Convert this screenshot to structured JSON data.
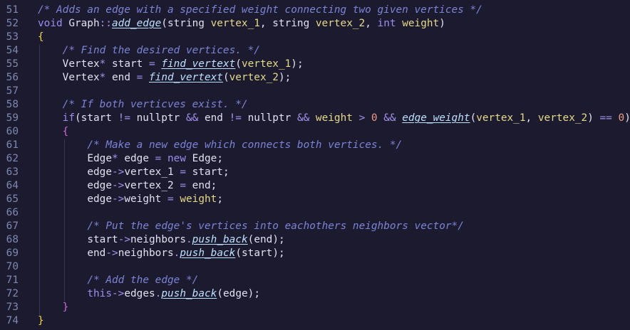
{
  "editor": {
    "lines": [
      {
        "n": "51",
        "indent": 0,
        "tokens": [
          {
            "t": "/* Adds an edge with a specified weight connecting two given vertices */",
            "c": "comment"
          }
        ]
      },
      {
        "n": "52",
        "indent": 0,
        "tokens": [
          {
            "t": "void",
            "c": "kw"
          },
          {
            "t": " Graph",
            "c": "plain"
          },
          {
            "t": "::",
            "c": "scope"
          },
          {
            "t": "add_edge",
            "c": "fn"
          },
          {
            "t": "(",
            "c": "paren"
          },
          {
            "t": "string",
            "c": "plain"
          },
          {
            "t": " vertex_1",
            "c": "param"
          },
          {
            "t": ", ",
            "c": "plain"
          },
          {
            "t": "string",
            "c": "plain"
          },
          {
            "t": " vertex_2",
            "c": "param"
          },
          {
            "t": ", ",
            "c": "plain"
          },
          {
            "t": "int",
            "c": "kw"
          },
          {
            "t": " weight",
            "c": "param"
          },
          {
            "t": ")",
            "c": "paren"
          }
        ]
      },
      {
        "n": "53",
        "indent": 0,
        "tokens": [
          {
            "t": "{",
            "c": "brace1"
          }
        ]
      },
      {
        "n": "54",
        "indent": 1,
        "tokens": [
          {
            "t": "/* Find the desired vertices. */",
            "c": "comment"
          }
        ]
      },
      {
        "n": "55",
        "indent": 1,
        "tokens": [
          {
            "t": "Vertex",
            "c": "plain"
          },
          {
            "t": "*",
            "c": "op"
          },
          {
            "t": " start ",
            "c": "plain"
          },
          {
            "t": "=",
            "c": "op"
          },
          {
            "t": " ",
            "c": "plain"
          },
          {
            "t": "find_vertext",
            "c": "fn"
          },
          {
            "t": "(",
            "c": "paren"
          },
          {
            "t": "vertex_1",
            "c": "param"
          },
          {
            "t": ");",
            "c": "paren"
          }
        ]
      },
      {
        "n": "56",
        "indent": 1,
        "tokens": [
          {
            "t": "Vertex",
            "c": "plain"
          },
          {
            "t": "*",
            "c": "op"
          },
          {
            "t": " end ",
            "c": "plain"
          },
          {
            "t": "=",
            "c": "op"
          },
          {
            "t": " ",
            "c": "plain"
          },
          {
            "t": "find_vertext",
            "c": "fn"
          },
          {
            "t": "(",
            "c": "paren"
          },
          {
            "t": "vertex_2",
            "c": "param"
          },
          {
            "t": ");",
            "c": "paren"
          }
        ]
      },
      {
        "n": "57",
        "indent": 1,
        "tokens": []
      },
      {
        "n": "58",
        "indent": 1,
        "tokens": [
          {
            "t": "/* If both verticves exist. */",
            "c": "comment"
          }
        ]
      },
      {
        "n": "59",
        "indent": 1,
        "tokens": [
          {
            "t": "if",
            "c": "kw"
          },
          {
            "t": "(",
            "c": "paren"
          },
          {
            "t": "start ",
            "c": "plain"
          },
          {
            "t": "!=",
            "c": "op"
          },
          {
            "t": " nullptr ",
            "c": "plain"
          },
          {
            "t": "&&",
            "c": "op"
          },
          {
            "t": " end ",
            "c": "plain"
          },
          {
            "t": "!=",
            "c": "op"
          },
          {
            "t": " nullptr ",
            "c": "plain"
          },
          {
            "t": "&&",
            "c": "op"
          },
          {
            "t": " weight",
            "c": "param"
          },
          {
            "t": " > ",
            "c": "op"
          },
          {
            "t": "0",
            "c": "num"
          },
          {
            "t": " && ",
            "c": "op"
          },
          {
            "t": "edge_weight",
            "c": "fn"
          },
          {
            "t": "(",
            "c": "paren"
          },
          {
            "t": "vertex_1",
            "c": "param"
          },
          {
            "t": ", ",
            "c": "plain"
          },
          {
            "t": "vertex_2",
            "c": "param"
          },
          {
            "t": ")",
            "c": "paren"
          },
          {
            "t": " == ",
            "c": "op"
          },
          {
            "t": "0",
            "c": "num"
          },
          {
            "t": ")",
            "c": "paren"
          }
        ]
      },
      {
        "n": "60",
        "indent": 1,
        "tokens": [
          {
            "t": "{",
            "c": "brace2"
          }
        ]
      },
      {
        "n": "61",
        "indent": 2,
        "tokens": [
          {
            "t": "/* Make a new edge which connects both vertices. */",
            "c": "comment"
          }
        ]
      },
      {
        "n": "62",
        "indent": 2,
        "tokens": [
          {
            "t": "Edge",
            "c": "plain"
          },
          {
            "t": "*",
            "c": "op"
          },
          {
            "t": " edge ",
            "c": "plain"
          },
          {
            "t": "=",
            "c": "op"
          },
          {
            "t": " new",
            "c": "kw"
          },
          {
            "t": " Edge;",
            "c": "plain"
          }
        ]
      },
      {
        "n": "63",
        "indent": 2,
        "tokens": [
          {
            "t": "edge",
            "c": "plain"
          },
          {
            "t": "->",
            "c": "op"
          },
          {
            "t": "vertex_1",
            "c": "plain"
          },
          {
            "t": " = ",
            "c": "op"
          },
          {
            "t": "start;",
            "c": "plain"
          }
        ]
      },
      {
        "n": "64",
        "indent": 2,
        "tokens": [
          {
            "t": "edge",
            "c": "plain"
          },
          {
            "t": "->",
            "c": "op"
          },
          {
            "t": "vertex_2",
            "c": "plain"
          },
          {
            "t": " = ",
            "c": "op"
          },
          {
            "t": "end;",
            "c": "plain"
          }
        ]
      },
      {
        "n": "65",
        "indent": 2,
        "tokens": [
          {
            "t": "edge",
            "c": "plain"
          },
          {
            "t": "->",
            "c": "op"
          },
          {
            "t": "weight",
            "c": "plain"
          },
          {
            "t": " = ",
            "c": "op"
          },
          {
            "t": "weight",
            "c": "param"
          },
          {
            "t": ";",
            "c": "plain"
          }
        ]
      },
      {
        "n": "66",
        "indent": 2,
        "tokens": []
      },
      {
        "n": "67",
        "indent": 2,
        "tokens": [
          {
            "t": "/* Put the edge's vertices into eachothers neighbors vector*/",
            "c": "comment"
          }
        ]
      },
      {
        "n": "68",
        "indent": 2,
        "tokens": [
          {
            "t": "start",
            "c": "plain"
          },
          {
            "t": "->",
            "c": "op"
          },
          {
            "t": "neighbors",
            "c": "plain"
          },
          {
            "t": ".",
            "c": "op"
          },
          {
            "t": "push_back",
            "c": "fn"
          },
          {
            "t": "(",
            "c": "paren"
          },
          {
            "t": "end",
            "c": "plain"
          },
          {
            "t": ");",
            "c": "paren"
          }
        ]
      },
      {
        "n": "69",
        "indent": 2,
        "tokens": [
          {
            "t": "end",
            "c": "plain"
          },
          {
            "t": "->",
            "c": "op"
          },
          {
            "t": "neighbors",
            "c": "plain"
          },
          {
            "t": ".",
            "c": "op"
          },
          {
            "t": "push_back",
            "c": "fn"
          },
          {
            "t": "(",
            "c": "paren"
          },
          {
            "t": "start",
            "c": "plain"
          },
          {
            "t": ");",
            "c": "paren"
          }
        ]
      },
      {
        "n": "70",
        "indent": 2,
        "tokens": []
      },
      {
        "n": "71",
        "indent": 2,
        "tokens": [
          {
            "t": "/* Add the edge */",
            "c": "comment"
          }
        ]
      },
      {
        "n": "72",
        "indent": 2,
        "tokens": [
          {
            "t": "this",
            "c": "kw"
          },
          {
            "t": "->",
            "c": "op"
          },
          {
            "t": "edges",
            "c": "plain"
          },
          {
            "t": ".",
            "c": "op"
          },
          {
            "t": "push_back",
            "c": "fn"
          },
          {
            "t": "(",
            "c": "paren"
          },
          {
            "t": "edge",
            "c": "plain"
          },
          {
            "t": ");",
            "c": "paren"
          }
        ]
      },
      {
        "n": "73",
        "indent": 1,
        "tokens": [
          {
            "t": "}",
            "c": "brace2"
          }
        ]
      },
      {
        "n": "74",
        "indent": 0,
        "tokens": [
          {
            "t": "}",
            "c": "brace1"
          }
        ]
      }
    ],
    "colors": {
      "background": "#1c1a2e",
      "line_numbers": "#7c89b0",
      "comment": "#7b84d6",
      "keyword": "#9d8df0",
      "function": "#bde0ff",
      "parameter": "#e6d98a",
      "number": "#f09a8a",
      "brace_level_1": "#f5d547",
      "brace_level_2": "#d06ad8"
    }
  }
}
